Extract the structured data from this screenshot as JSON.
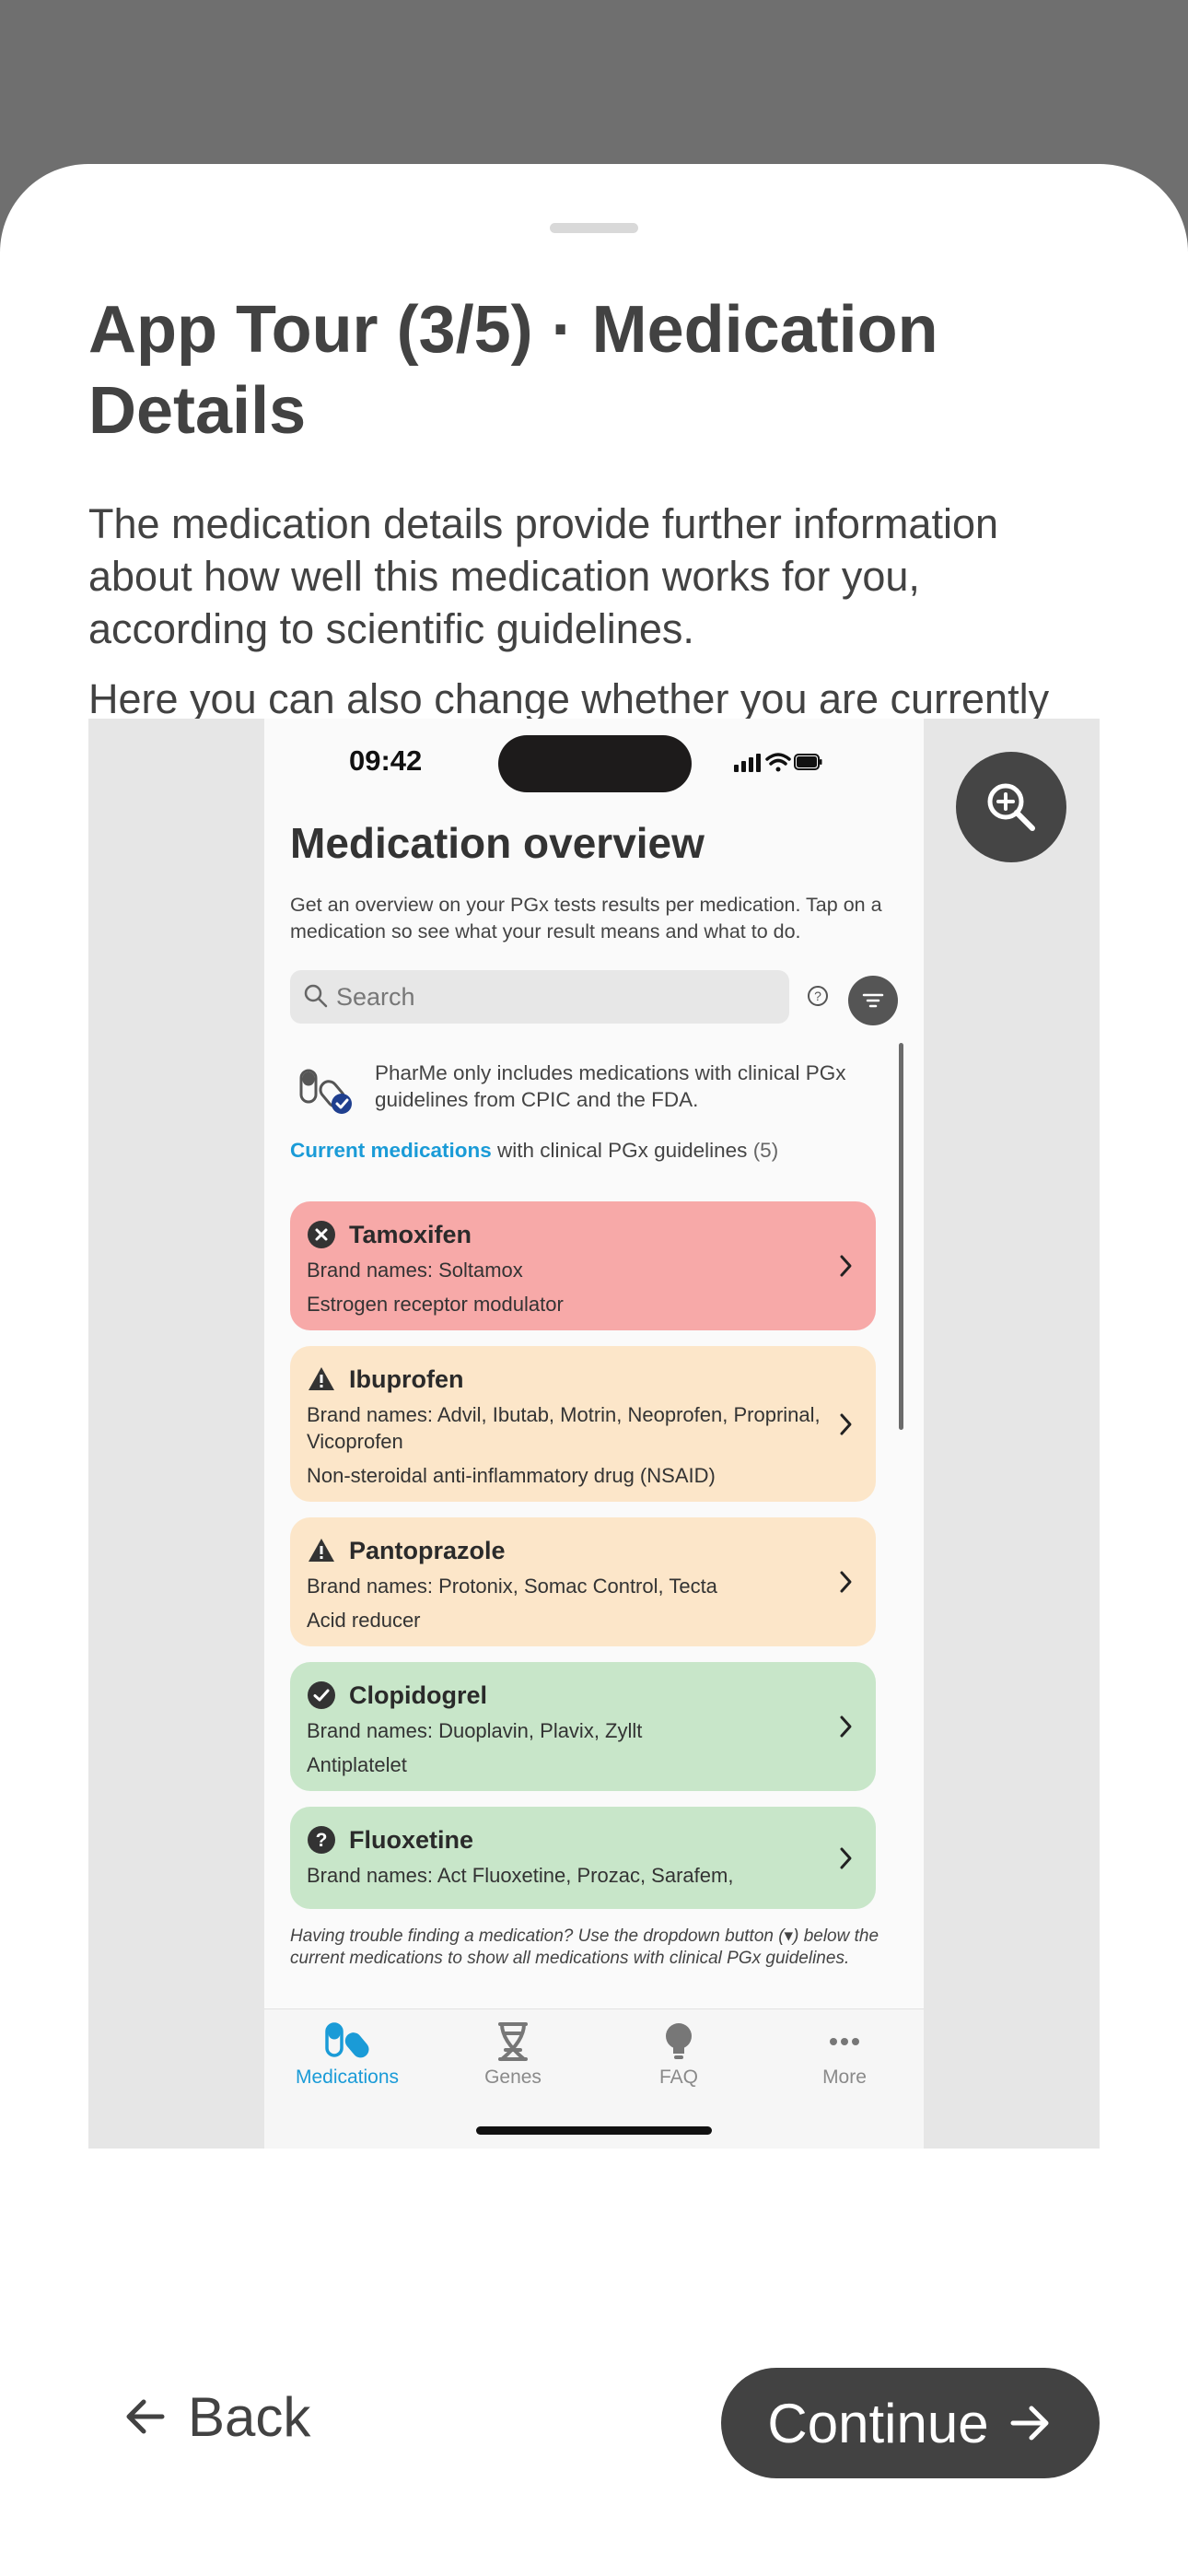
{
  "sheet": {
    "title": "App Tour (3/5) · Medication Details",
    "paragraphs": [
      "The medication details provide further information about how well this medication works for you, according to scientific guidelines.",
      "Here you can also change whether you are currently taking a medication and save a PDF report for healthcare professionals."
    ]
  },
  "preview": {
    "zoom_icon": "zoom-in-icon",
    "phone": {
      "status_time": "09:42",
      "title": "Medication overview",
      "intro": "Get an overview on your PGx tests results per medication. Tap on a medication so see what your result means and what to do.",
      "search_placeholder": "Search",
      "info_text": "PharMe only includes medications with clinical PGx guidelines from CPIC and the FDA.",
      "current_link": "Current medications",
      "current_rest": " with clinical PGx guidelines ",
      "current_count": "(5)",
      "medications": [
        {
          "name": "Tamoxifen",
          "brands": "Brand names: Soltamox",
          "class": "Estrogen receptor modulator",
          "status": "red",
          "icon": "x-circle-icon"
        },
        {
          "name": "Ibuprofen",
          "brands": "Brand names: Advil, Ibutab, Motrin, Neoprofen, Proprinal, Vicoprofen",
          "class": "Non-steroidal anti-inflammatory drug (NSAID)",
          "status": "orange",
          "icon": "warning-icon"
        },
        {
          "name": "Pantoprazole",
          "brands": "Brand names: Protonix, Somac Control, Tecta",
          "class": "Acid reducer",
          "status": "orange",
          "icon": "warning-icon"
        },
        {
          "name": "Clopidogrel",
          "brands": "Brand names: Duoplavin, Plavix, Zyllt",
          "class": "Antiplatelet",
          "status": "green",
          "icon": "check-circle-icon"
        },
        {
          "name": "Fluoxetine",
          "brands": "Brand names: Act Fluoxetine, Prozac, Sarafem,",
          "class": "",
          "status": "green",
          "icon": "question-circle-icon"
        }
      ],
      "hint": "Having trouble finding a medication? Use the dropdown button (▾) below the current medications to show all medications with clinical PGx guidelines.",
      "tabs": [
        {
          "label": "Medications",
          "active": true
        },
        {
          "label": "Genes",
          "active": false
        },
        {
          "label": "FAQ",
          "active": false
        },
        {
          "label": "More",
          "active": false
        }
      ],
      "colors": {
        "accent": "#1a9bd7",
        "red": "#f7a9a8",
        "orange": "#fce6c9",
        "green": "#c8e6c9"
      }
    }
  },
  "footer": {
    "back_label": "Back",
    "continue_label": "Continue"
  }
}
